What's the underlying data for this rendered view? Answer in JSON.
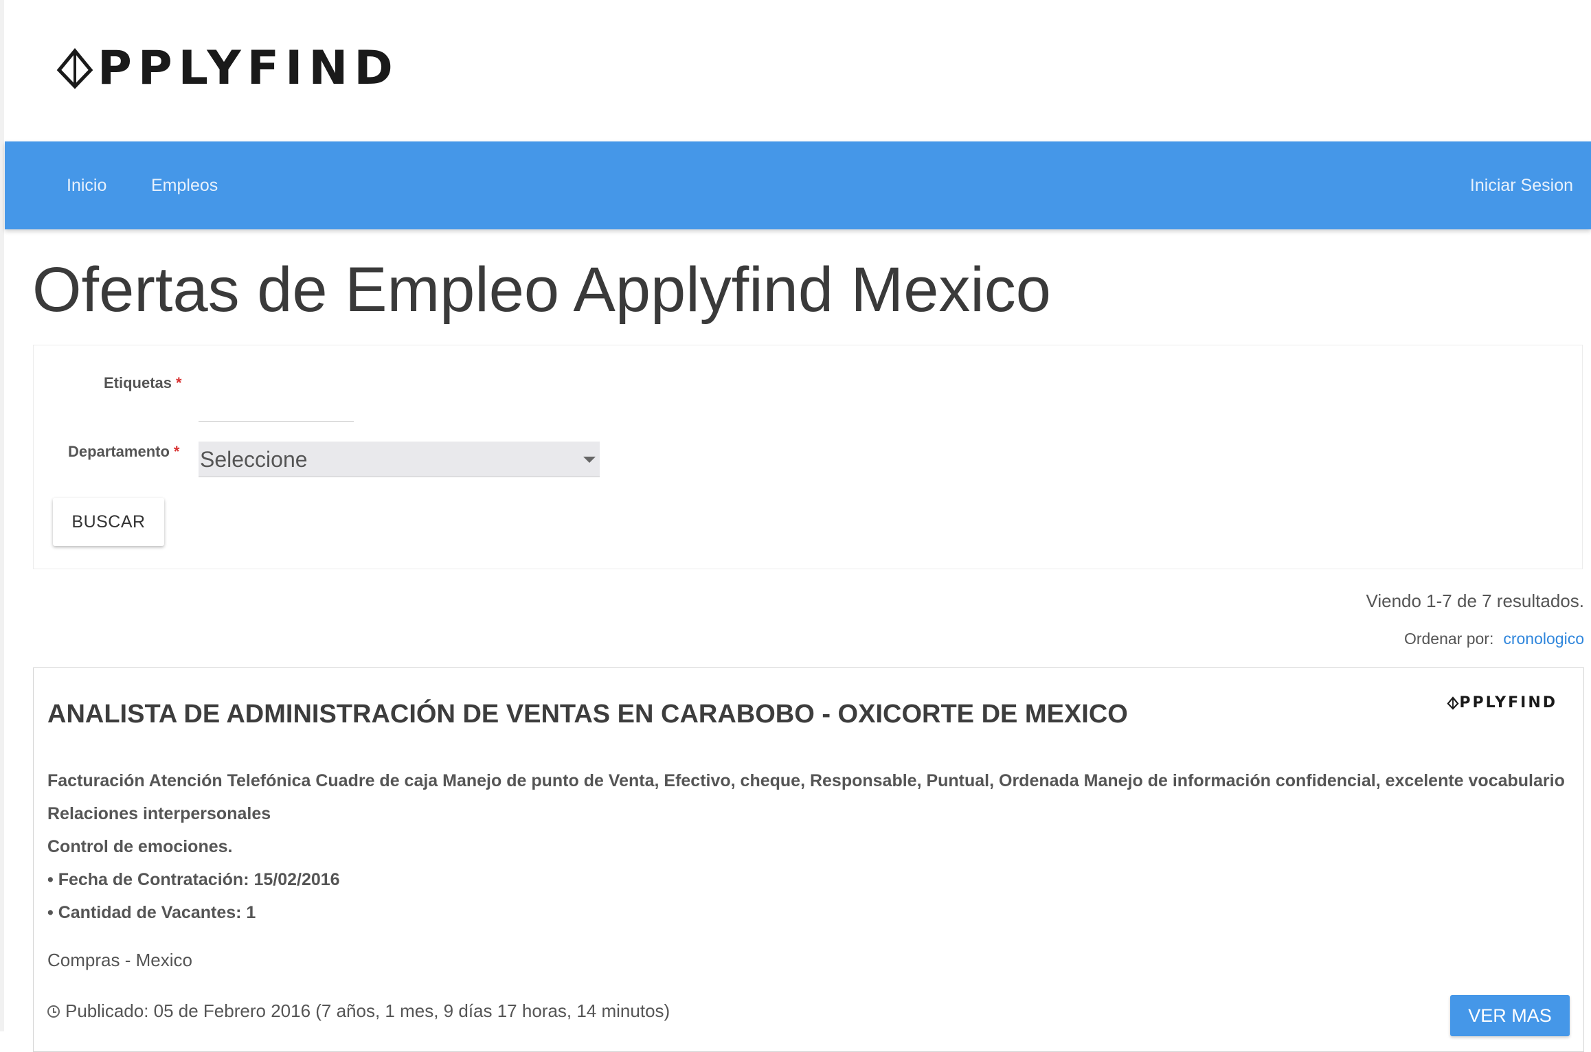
{
  "brand": {
    "logo_text": "PPLYFIND",
    "logo_icon": "diamond-a-icon"
  },
  "nav": {
    "items": [
      {
        "label": "Inicio"
      },
      {
        "label": "Empleos"
      }
    ],
    "login_label": "Iniciar Sesion"
  },
  "page": {
    "title": "Ofertas de Empleo Applyfind Mexico"
  },
  "search": {
    "tags_label": "Etiquetas",
    "tags_value": "",
    "department_label": "Departamento",
    "department_selected": "Seleccione",
    "required_mark": "*",
    "button_label": "BUSCAR"
  },
  "results": {
    "summary": "Viendo 1-7 de 7 resultados.",
    "order_label": "Ordenar por:",
    "order_value": "cronologico"
  },
  "jobs": [
    {
      "title": "ANALISTA DE ADMINISTRACIÓN DE VENTAS EN CARABOBO - OXICORTE DE MEXICO",
      "logo_text": "PPLYFIND",
      "description_lines": [
        "Facturación Atención Telefónica Cuadre de caja Manejo de punto de Venta, Efectivo, cheque, Responsable, Puntual, Ordenada Manejo de información confidencial, excelente vocabulario",
        "Relaciones interpersonales",
        "Control de emociones.",
        "• Fecha de Contratación: 15/02/2016",
        "• Cantidad de Vacantes: 1"
      ],
      "location": "Compras - Mexico",
      "published": "Publicado: 05 de Febrero 2016 (7 años, 1 mes, 9 días 17 horas, 14 minutos)",
      "button_label": "VER MAS"
    }
  ],
  "colors": {
    "navbar": "#4597e8",
    "link": "#2f86dc",
    "required": "#d83232"
  }
}
